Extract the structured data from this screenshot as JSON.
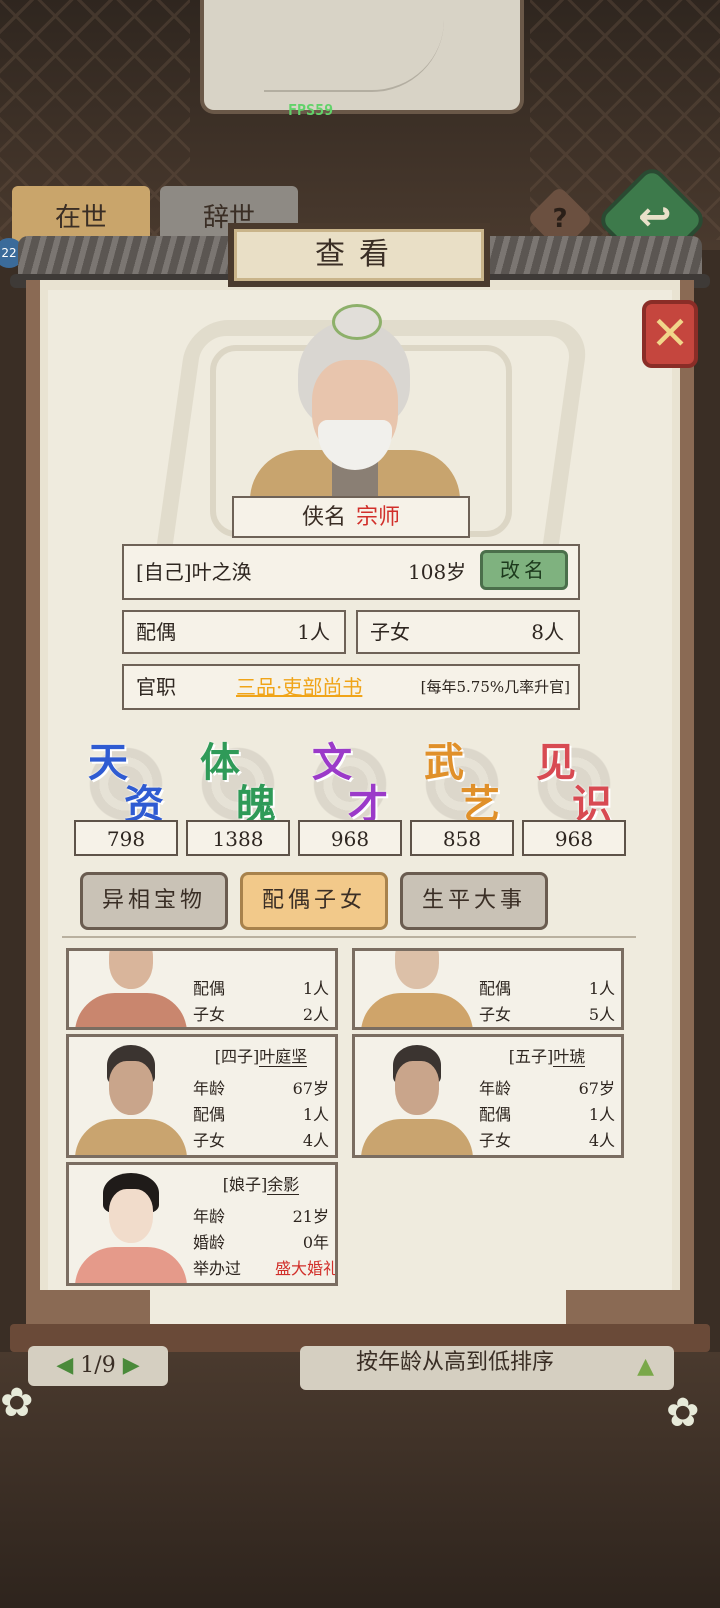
{
  "fps": "FPS59",
  "background": {
    "tabs": [
      "在世",
      "辞世"
    ],
    "help_icon": "?",
    "back_icon": "back-arrow",
    "level_badge": "22"
  },
  "dialog": {
    "title": "查看",
    "close_icon": "close-x"
  },
  "character": {
    "nickname_label": "侠名",
    "nickname": "宗师",
    "identity": "[自己]叶之涣",
    "age": "108岁",
    "rename_label": "改名",
    "spouse_label": "配偶",
    "spouse_count": "1人",
    "children_label": "子女",
    "children_count": "8人",
    "office_label": "官职",
    "office_rank": "三品·吏部尚书",
    "office_rate": "[每年5.75%几率升官]"
  },
  "attributes": [
    {
      "c1": "天",
      "c2": "资",
      "value": "798",
      "color": "#2f5bd2"
    },
    {
      "c1": "体",
      "c2": "魄",
      "value": "1388",
      "color": "#2f9a58"
    },
    {
      "c1": "文",
      "c2": "才",
      "value": "968",
      "color": "#9b3ac9"
    },
    {
      "c1": "武",
      "c2": "艺",
      "value": "858",
      "color": "#e0902a"
    },
    {
      "c1": "见",
      "c2": "识",
      "value": "968",
      "color": "#d84a52"
    }
  ],
  "tabs": [
    "异相宝物",
    "配偶子女",
    "生平大事"
  ],
  "active_tab": 1,
  "family_partial": [
    {
      "spouse_label": "配偶",
      "spouse": "1人",
      "children_label": "子女",
      "children": "2人"
    },
    {
      "spouse_label": "配偶",
      "spouse": "1人",
      "children_label": "子女",
      "children": "5人"
    }
  ],
  "family": [
    {
      "title": "[四子]",
      "name": "叶庭坚",
      "age_label": "年龄",
      "age": "67岁",
      "spouse_label": "配偶",
      "spouse": "1人",
      "children_label": "子女",
      "children": "4人"
    },
    {
      "title": "[五子]",
      "name": "叶琥",
      "age_label": "年龄",
      "age": "67岁",
      "spouse_label": "配偶",
      "spouse": "1人",
      "children_label": "子女",
      "children": "4人"
    },
    {
      "title": "[娘子]",
      "name": "余影",
      "age_label": "年龄",
      "age": "21岁",
      "marriage_label": "婚龄",
      "marriage": "0年",
      "wedding_label": "举办过",
      "wedding": "盛大婚礼"
    }
  ],
  "footer": {
    "page": "1/9",
    "sort_label": "按年龄从高到低排序"
  }
}
